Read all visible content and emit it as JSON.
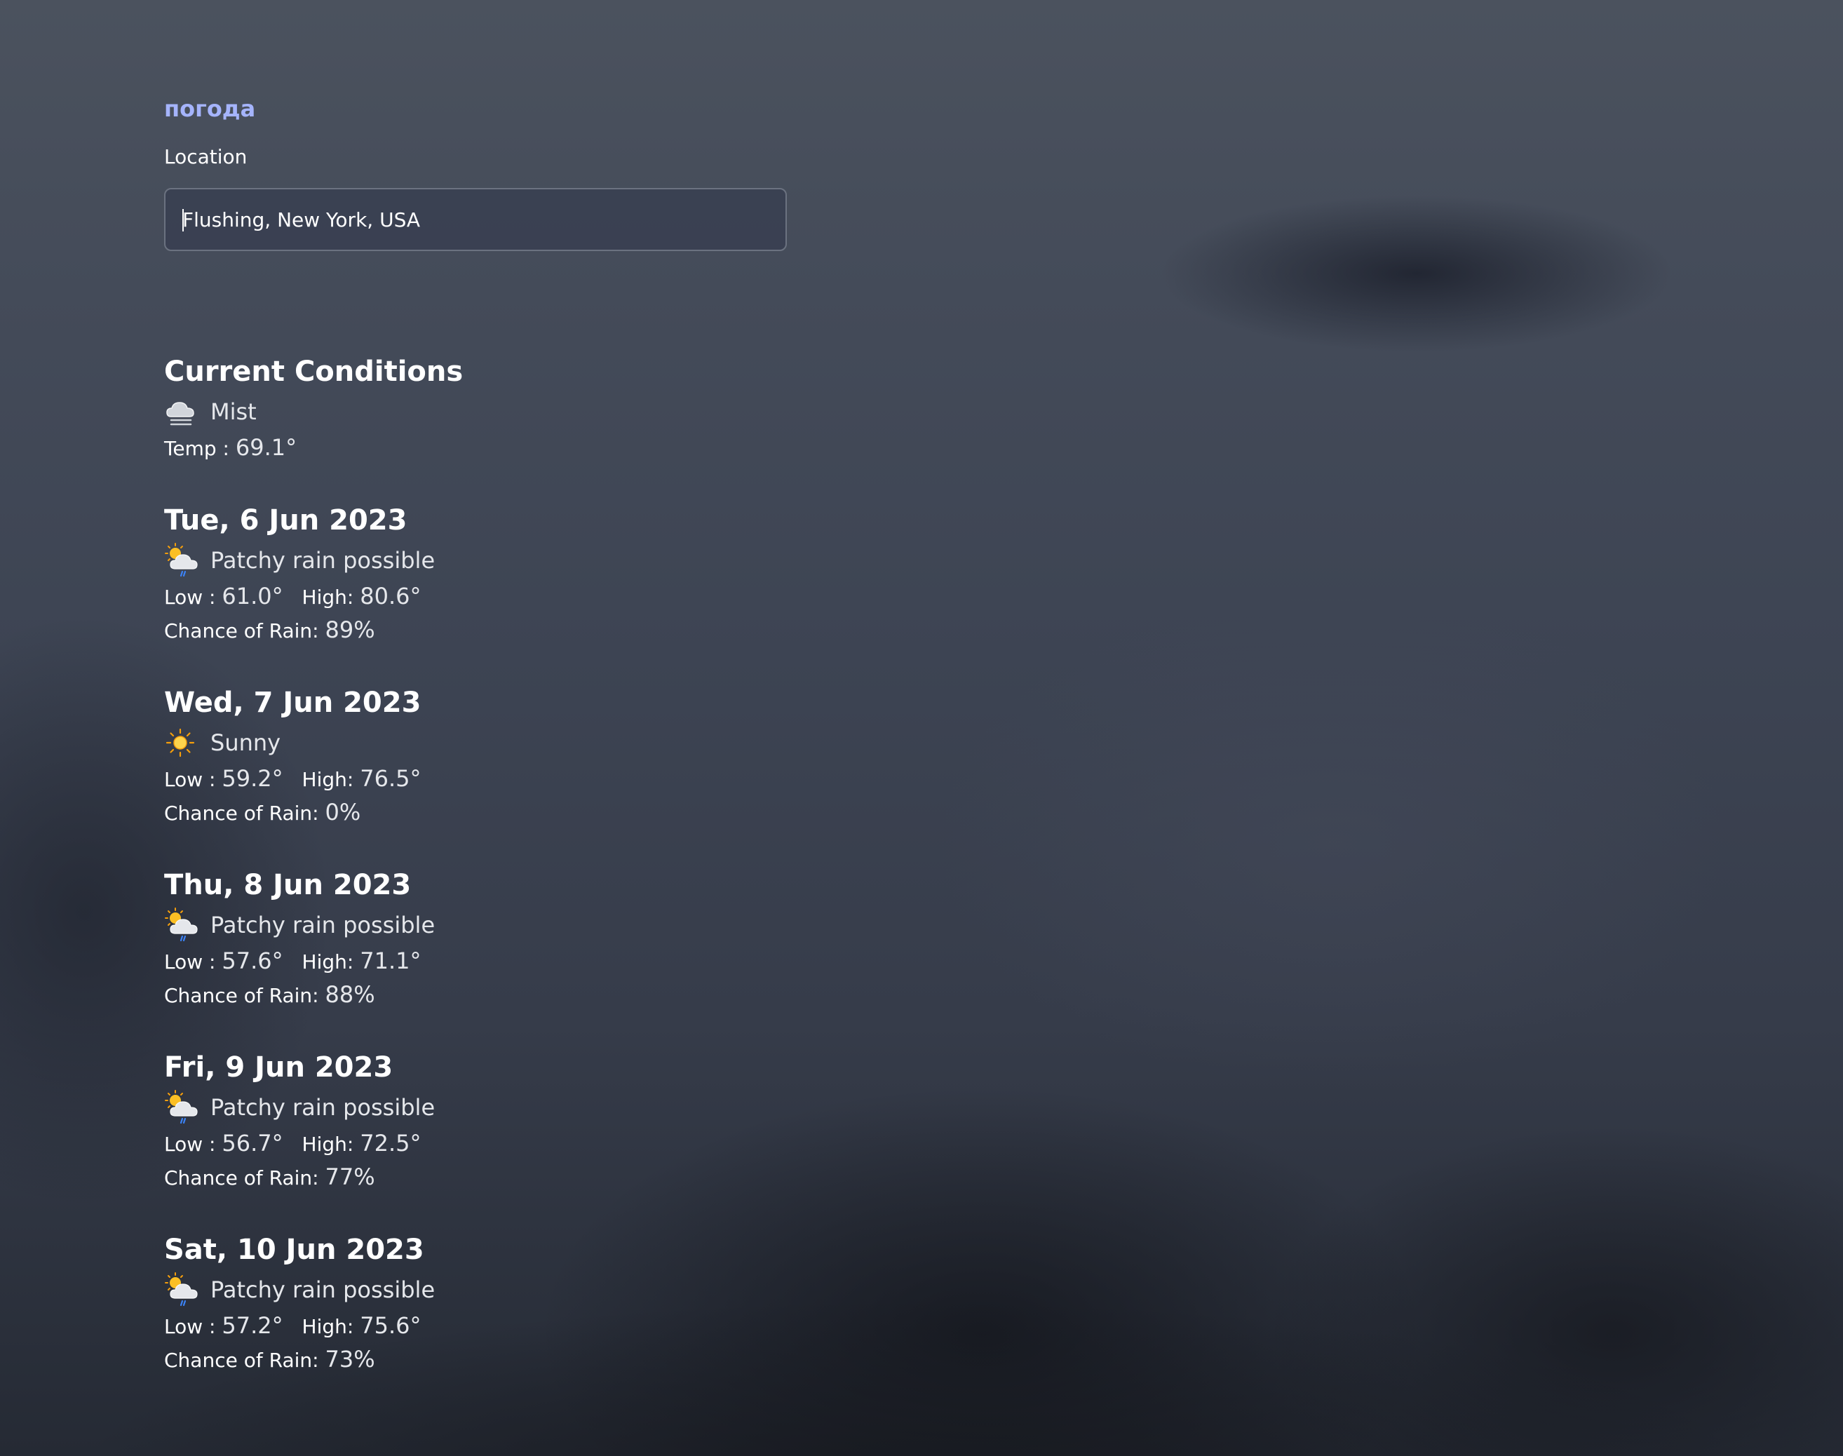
{
  "app": {
    "brand": "погода"
  },
  "search": {
    "label": "Location",
    "value": "Flushing, New York, USA"
  },
  "current": {
    "heading": "Current Conditions",
    "condition": "Mist",
    "icon": "mist-cloud-icon",
    "temp_label": "Temp :",
    "temp_value": "69.1°"
  },
  "labels": {
    "low": "Low :",
    "high": "High:",
    "rain": "Chance of Rain:"
  },
  "forecast": [
    {
      "date": "Tue, 6 Jun 2023",
      "condition": "Patchy rain possible",
      "icon": "patchy-rain-icon",
      "low": "61.0°",
      "high": "80.6°",
      "rain": "89%"
    },
    {
      "date": "Wed, 7 Jun 2023",
      "condition": "Sunny",
      "icon": "sun-icon",
      "low": "59.2°",
      "high": "76.5°",
      "rain": "0%"
    },
    {
      "date": "Thu, 8 Jun 2023",
      "condition": "Patchy rain possible",
      "icon": "patchy-rain-icon",
      "low": "57.6°",
      "high": "71.1°",
      "rain": "88%"
    },
    {
      "date": "Fri, 9 Jun 2023",
      "condition": "Patchy rain possible",
      "icon": "patchy-rain-icon",
      "low": "56.7°",
      "high": "72.5°",
      "rain": "77%"
    },
    {
      "date": "Sat, 10 Jun 2023",
      "condition": "Patchy rain possible",
      "icon": "patchy-rain-icon",
      "low": "57.2°",
      "high": "75.6°",
      "rain": "73%"
    }
  ]
}
